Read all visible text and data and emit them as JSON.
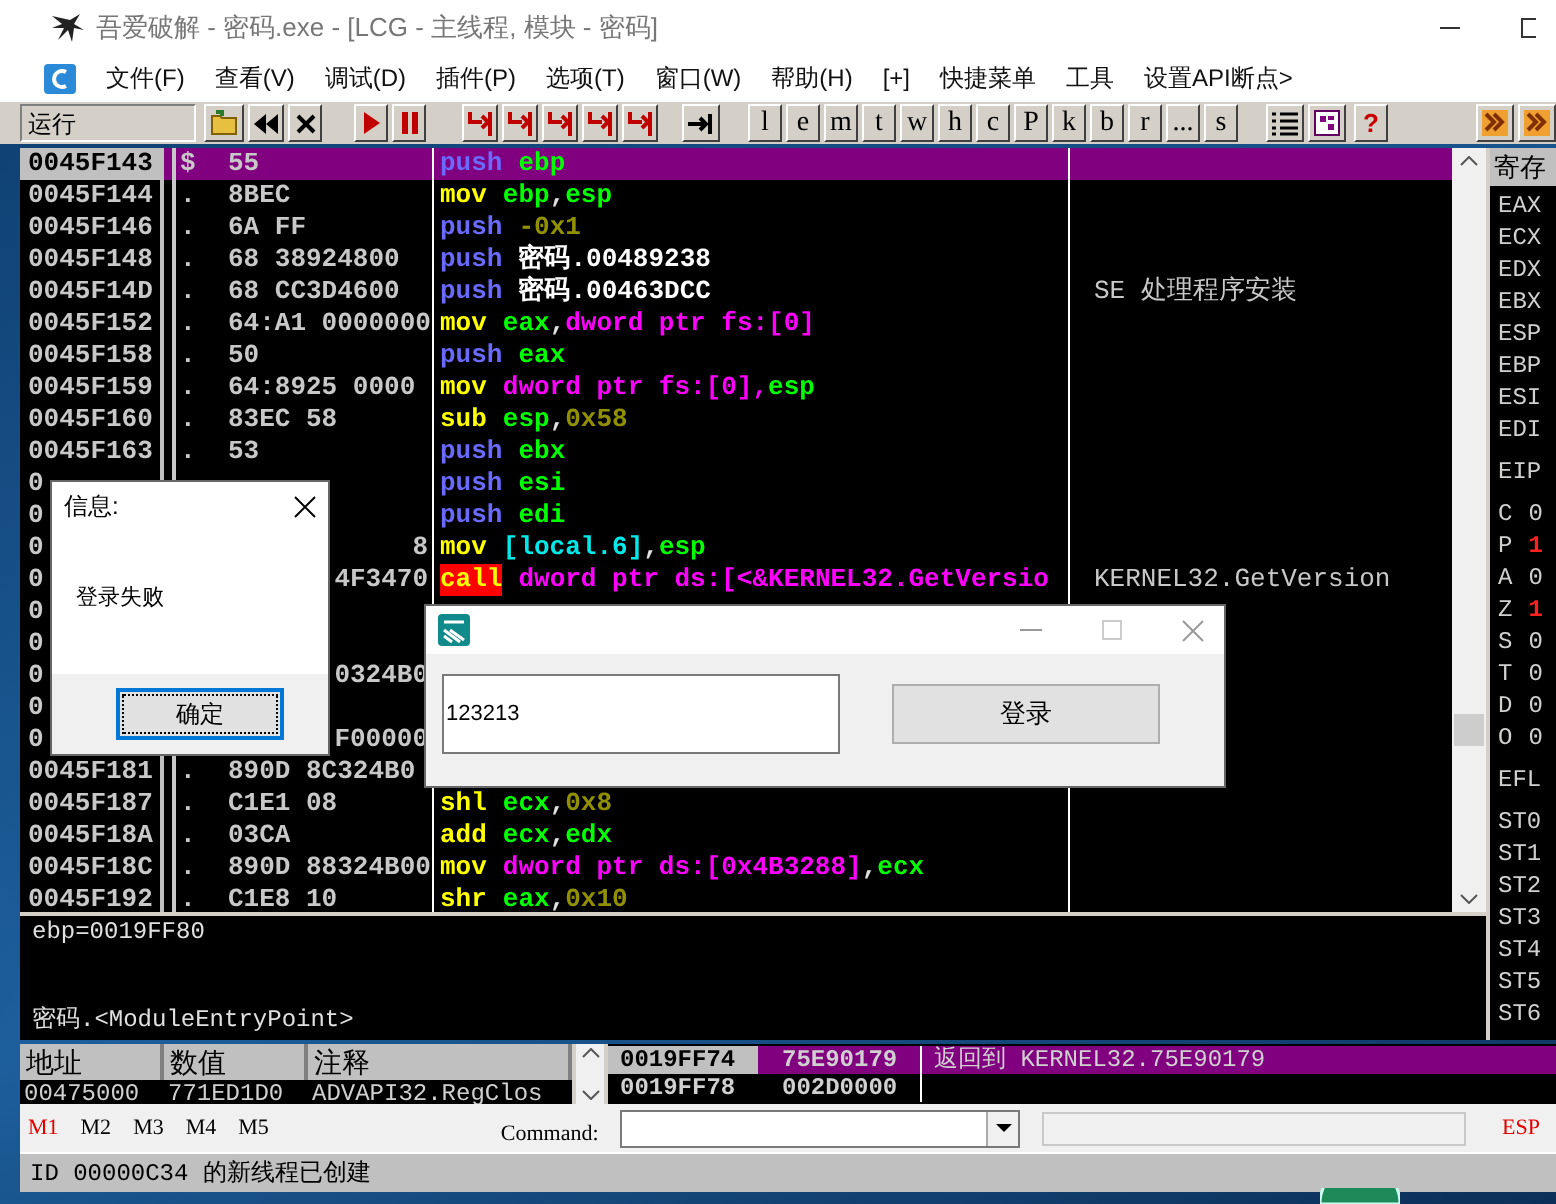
{
  "window": {
    "title": "吾爱破解 - 密码.exe - [LCG -  主线程, 模块 - 密码]"
  },
  "menu": [
    "文件(F)",
    "查看(V)",
    "调试(D)",
    "插件(P)",
    "选项(T)",
    "窗口(W)",
    "帮助(H)",
    "[+]",
    "快捷菜单",
    "工具",
    "设置API断点>"
  ],
  "toolbar": {
    "status": "运行",
    "letters": [
      "l",
      "e",
      "m",
      "t",
      "w",
      "h",
      "c",
      "P",
      "k",
      "b",
      "r",
      "...",
      "s"
    ],
    "help": "?"
  },
  "disasm": [
    {
      "addr": "0045F143",
      "mark": "$",
      "hex": "55",
      "selected": true,
      "asm": [
        {
          "kind": "push",
          "text": "push"
        },
        {
          "kind": "reg",
          "text": "ebp"
        }
      ]
    },
    {
      "addr": "0045F144",
      "mark": ".",
      "hex": "8BEC",
      "selected": false,
      "asm": [
        {
          "kind": "op",
          "text": "mov"
        },
        {
          "kind": "reg",
          "text": "ebp"
        },
        {
          "kind": "sep",
          "text": ","
        },
        {
          "kind": "reg",
          "text": "esp"
        }
      ]
    },
    {
      "addr": "0045F146",
      "mark": ".",
      "hex": "6A FF",
      "selected": false,
      "asm": [
        {
          "kind": "push",
          "text": "push"
        },
        {
          "kind": "num",
          "text": "-0x1"
        }
      ]
    },
    {
      "addr": "0045F148",
      "mark": ".",
      "hex": "68 38924800",
      "selected": false,
      "asm": [
        {
          "kind": "push",
          "text": "push"
        },
        {
          "kind": "sym",
          "text": "密码.00489238"
        }
      ]
    },
    {
      "addr": "0045F14D",
      "mark": ".",
      "hex": "68 CC3D4600",
      "selected": false,
      "asm": [
        {
          "kind": "push",
          "text": "push"
        },
        {
          "kind": "sym",
          "text": "密码.00463DCC"
        }
      ],
      "comment": "SE 处理程序安装"
    },
    {
      "addr": "0045F152",
      "mark": ".",
      "hex": "64:A1 0000000",
      "selected": false,
      "asm": [
        {
          "kind": "op",
          "text": "mov"
        },
        {
          "kind": "reg",
          "text": "eax"
        },
        {
          "kind": "sep",
          "text": ","
        },
        {
          "kind": "mem",
          "text": "dword ptr fs:[0]"
        }
      ]
    },
    {
      "addr": "0045F158",
      "mark": ".",
      "hex": "50",
      "selected": false,
      "asm": [
        {
          "kind": "push",
          "text": "push"
        },
        {
          "kind": "reg",
          "text": "eax"
        }
      ]
    },
    {
      "addr": "0045F159",
      "mark": ".",
      "hex": "64:8925 0000",
      "selected": false,
      "asm": [
        {
          "kind": "op",
          "text": "mov"
        },
        {
          "kind": "mem",
          "text": "dword ptr fs:[0],"
        },
        {
          "kind": "reg",
          "text": "esp"
        }
      ]
    },
    {
      "addr": "0045F160",
      "mark": ".",
      "hex": "83EC 58",
      "selected": false,
      "asm": [
        {
          "kind": "op",
          "text": "sub"
        },
        {
          "kind": "reg",
          "text": "esp"
        },
        {
          "kind": "sep",
          "text": ","
        },
        {
          "kind": "num",
          "text": "0x58"
        }
      ]
    },
    {
      "addr": "0045F163",
      "mark": ".",
      "hex": "53",
      "selected": false,
      "asm": [
        {
          "kind": "push",
          "text": "push"
        },
        {
          "kind": "reg",
          "text": "ebx"
        }
      ]
    },
    {
      "addr": "0",
      "selected": false,
      "asm": [
        {
          "kind": "push",
          "text": "push"
        },
        {
          "kind": "reg",
          "text": "esi"
        }
      ]
    },
    {
      "addr": "0",
      "selected": false,
      "asm": [
        {
          "kind": "push",
          "text": "push"
        },
        {
          "kind": "reg",
          "text": "edi"
        }
      ]
    },
    {
      "addr": "0",
      "hex_tail": "8",
      "selected": false,
      "asm": [
        {
          "kind": "op",
          "text": "mov"
        },
        {
          "kind": "local",
          "text": "[local.6]"
        },
        {
          "kind": "sep",
          "text": ","
        },
        {
          "kind": "reg",
          "text": "esp"
        }
      ]
    },
    {
      "addr": "0",
      "hex_tail": "4F3470",
      "selected": false,
      "asm": [
        {
          "kind": "call",
          "text": "call"
        },
        {
          "kind": "mem",
          "text": "dword ptr ds:[<&KERNEL32.GetVersio"
        }
      ],
      "comment": "KERNEL32.GetVersion"
    },
    {
      "addr": "0",
      "selected": false
    },
    {
      "addr": "0",
      "selected": false
    },
    {
      "addr": "0",
      "hex_tail": "0324B0",
      "selected": false
    },
    {
      "addr": "0",
      "selected": false
    },
    {
      "addr": "0",
      "hex_tail": "F00000",
      "selected": false
    },
    {
      "addr": "0045F181",
      "mark": ".",
      "hex": "890D 8C324B0",
      "selected": false
    },
    {
      "addr": "0045F187",
      "mark": ".",
      "hex": "C1E1 08",
      "selected": false,
      "asm": [
        {
          "kind": "op",
          "text": "shl"
        },
        {
          "kind": "reg",
          "text": "ecx"
        },
        {
          "kind": "sep",
          "text": ","
        },
        {
          "kind": "num",
          "text": "0x8"
        }
      ]
    },
    {
      "addr": "0045F18A",
      "mark": ".",
      "hex": "03CA",
      "selected": false,
      "asm": [
        {
          "kind": "op",
          "text": "add"
        },
        {
          "kind": "reg",
          "text": "ecx"
        },
        {
          "kind": "sep",
          "text": ","
        },
        {
          "kind": "reg",
          "text": "edx"
        }
      ]
    },
    {
      "addr": "0045F18C",
      "mark": ".",
      "hex": "890D 88324B00",
      "selected": false,
      "asm": [
        {
          "kind": "op",
          "text": "mov"
        },
        {
          "kind": "mem",
          "text": "dword ptr ds:[0x4B3288]"
        },
        {
          "kind": "sep",
          "text": ","
        },
        {
          "kind": "reg",
          "text": "ecx"
        }
      ]
    },
    {
      "addr": "0045F192",
      "mark": ".",
      "hex": "C1E8 10",
      "selected": false,
      "asm": [
        {
          "kind": "op",
          "text": "shr"
        },
        {
          "kind": "reg",
          "text": "eax"
        },
        {
          "kind": "sep",
          "text": ","
        },
        {
          "kind": "num",
          "text": "0x10"
        }
      ]
    }
  ],
  "registers": {
    "header": "寄存",
    "general": [
      "EAX",
      "ECX",
      "EDX",
      "EBX",
      "ESP",
      "EBP",
      "ESI",
      "EDI"
    ],
    "eip": "EIP",
    "flags": [
      {
        "name": "C",
        "value": "0",
        "changed": false
      },
      {
        "name": "P",
        "value": "1",
        "changed": true
      },
      {
        "name": "A",
        "value": "0",
        "changed": false
      },
      {
        "name": "Z",
        "value": "1",
        "changed": true
      },
      {
        "name": "S",
        "value": "0",
        "changed": false
      },
      {
        "name": "T",
        "value": "0",
        "changed": false
      },
      {
        "name": "D",
        "value": "0",
        "changed": false
      },
      {
        "name": "O",
        "value": "0",
        "changed": false
      }
    ],
    "efl": "EFL",
    "fpu": [
      "ST0",
      "ST1",
      "ST2",
      "ST3",
      "ST4",
      "ST5",
      "ST6"
    ]
  },
  "info": {
    "top": "ebp=0019FF80",
    "bottom": "密码.<ModuleEntryPoint>"
  },
  "dump": {
    "columns": [
      "地址",
      "数值",
      "注释"
    ],
    "row": [
      "00475000",
      "771ED1D0",
      "ADVAPI32.RegClos"
    ]
  },
  "stack": [
    {
      "addr": "0019FF74",
      "value": "75E90179",
      "comment": "返回到 KERNEL32.75E90179",
      "selected": true
    },
    {
      "addr": "0019FF78",
      "value": "002D0000",
      "selected": false
    }
  ],
  "command_bar": {
    "memory_tabs": [
      {
        "label": "M1",
        "selected": true
      },
      {
        "label": "M2",
        "selected": false
      },
      {
        "label": "M3",
        "selected": false
      },
      {
        "label": "M4",
        "selected": false
      },
      {
        "label": "M5",
        "selected": false
      }
    ],
    "label": "Command:",
    "register": "ESP"
  },
  "status": "ID 00000C34 的新线程已创建",
  "message_box": {
    "title": "信息:",
    "message": "登录失败",
    "button": "确定"
  },
  "login_window": {
    "value": "123213",
    "button": "登录"
  }
}
